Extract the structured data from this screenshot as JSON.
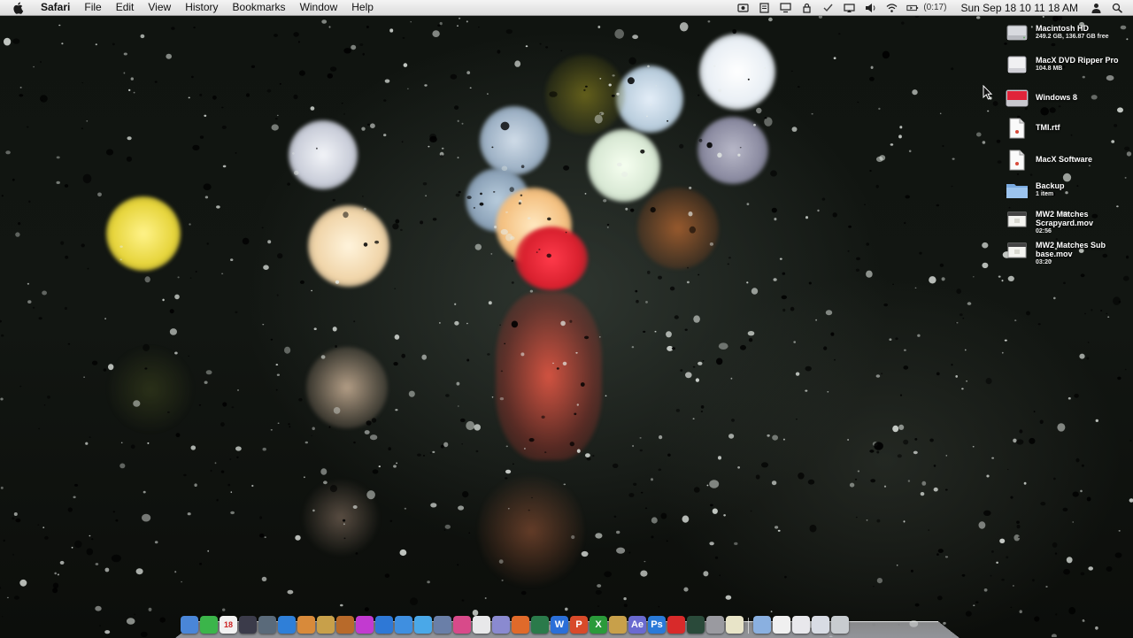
{
  "menubar": {
    "app_name": "Safari",
    "menus": [
      "File",
      "Edit",
      "View",
      "History",
      "Bookmarks",
      "Window",
      "Help"
    ],
    "battery_time": "(0:17)",
    "clock": "Sun Sep 18  10 11 18 AM",
    "status_icons": [
      "screen-record-icon",
      "caption-icon",
      "display-icon",
      "lock-icon",
      "checkmark-icon",
      "cast-icon",
      "volume-icon",
      "wifi-icon",
      "battery-icon",
      "user-icon",
      "spotlight-icon"
    ]
  },
  "desktop_items": [
    {
      "name": "Macintosh HD",
      "sub": "249.2 GB, 136.87 GB free",
      "icon": "hard-drive-icon"
    },
    {
      "name": "MacX DVD Ripper Pro",
      "sub": "104.8 MB",
      "icon": "disk-image-icon"
    },
    {
      "name": "Windows 8",
      "sub": "",
      "icon": "windows-drive-icon"
    },
    {
      "name": "TMI.rtf",
      "sub": "",
      "icon": "rtf-document-icon"
    },
    {
      "name": "MacX Software",
      "sub": "",
      "icon": "document-icon"
    },
    {
      "name": "Backup",
      "sub": "1 item",
      "icon": "folder-icon"
    },
    {
      "name": "MW2 Matches Scrapyard.mov",
      "sub": "02:56",
      "icon": "movie-file-icon"
    },
    {
      "name": "MW2 Matches Sub base.mov",
      "sub": "03:20",
      "icon": "movie-file-icon"
    }
  ],
  "dock": {
    "apps": [
      {
        "name": "finder-icon",
        "label": "",
        "color": "#4a86d8"
      },
      {
        "name": "spotify-icon",
        "label": "",
        "color": "#3bb54a"
      },
      {
        "name": "calendar-icon",
        "label": "18",
        "color": "#f2f2f2"
      },
      {
        "name": "itunes-icon",
        "label": "",
        "color": "#3b3b4a"
      },
      {
        "name": "camera-icon",
        "label": "",
        "color": "#5a6a7a"
      },
      {
        "name": "safari-icon",
        "label": "",
        "color": "#2f7fd8"
      },
      {
        "name": "photos-icon",
        "label": "",
        "color": "#d88a3a"
      },
      {
        "name": "star-app-icon",
        "label": "",
        "color": "#c8a04a"
      },
      {
        "name": "guitar-icon",
        "label": "",
        "color": "#b86a2a"
      },
      {
        "name": "purple-app-icon",
        "label": "",
        "color": "#c23ad0"
      },
      {
        "name": "app-store-icon",
        "label": "",
        "color": "#2e78d6"
      },
      {
        "name": "globe-icon",
        "label": "",
        "color": "#3f8fe0"
      },
      {
        "name": "twitter-icon",
        "label": "",
        "color": "#4aa8e8"
      },
      {
        "name": "preview-icon",
        "label": "",
        "color": "#6a7fa8"
      },
      {
        "name": "colorsync-icon",
        "label": "",
        "color": "#d84a8a"
      },
      {
        "name": "pages-icon",
        "label": "",
        "color": "#e8e8ea"
      },
      {
        "name": "pen-icon",
        "label": "",
        "color": "#8a8ad0"
      },
      {
        "name": "powerpoint-icon",
        "label": "",
        "color": "#e06a2a"
      },
      {
        "name": "keynote-icon",
        "label": "",
        "color": "#2a7a4a"
      },
      {
        "name": "word-icon",
        "label": "W",
        "color": "#2b6fd8"
      },
      {
        "name": "ppt-icon",
        "label": "P",
        "color": "#d84a2a"
      },
      {
        "name": "excel-icon",
        "label": "X",
        "color": "#2a9a3a"
      },
      {
        "name": "cube-icon",
        "label": "",
        "color": "#c8a04a"
      },
      {
        "name": "after-effects-icon",
        "label": "Ae",
        "color": "#6a6ad0"
      },
      {
        "name": "photoshop-icon",
        "label": "Ps",
        "color": "#2a7ad8"
      },
      {
        "name": "red-app-icon",
        "label": "",
        "color": "#d82a2a"
      },
      {
        "name": "activity-monitor-icon",
        "label": "",
        "color": "#2a4a3a"
      },
      {
        "name": "utility-icon",
        "label": "",
        "color": "#9a9aa0"
      },
      {
        "name": "notes-icon",
        "label": "",
        "color": "#e8e4c8"
      }
    ],
    "stacks": [
      {
        "name": "folder-stack-icon",
        "color": "#8ab0e0"
      },
      {
        "name": "document-stack-icon",
        "color": "#f0f0f0"
      },
      {
        "name": "downloads-stack-icon",
        "color": "#e8e8ec"
      },
      {
        "name": "mail-stack-icon",
        "color": "#d8dce4"
      },
      {
        "name": "trash-icon",
        "color": "#c8ccd0"
      }
    ]
  }
}
